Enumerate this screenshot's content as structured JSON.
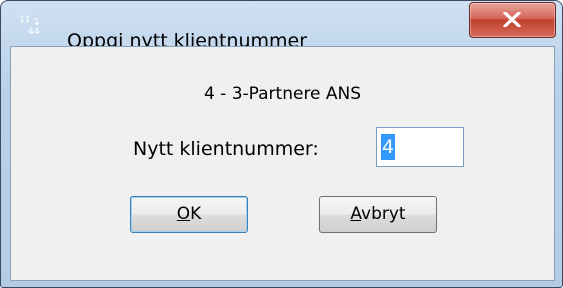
{
  "window": {
    "title": "Oppgi nytt klientnummer",
    "icon": {
      "name": "client-number-icon",
      "top_digits": "11",
      "arrow": "↴",
      "bottom_digits": "44"
    }
  },
  "dialog": {
    "client_name": "4 - 3-Partnere ANS",
    "field_label": "Nytt klientnummer:",
    "field_value": "4"
  },
  "buttons": {
    "ok": {
      "accel": "O",
      "rest": "K"
    },
    "cancel": {
      "accel": "A",
      "rest": "vbryt"
    }
  },
  "colors": {
    "close_button": "#c2402f",
    "selection": "#3399ff",
    "frame": "#b9d1ea"
  }
}
